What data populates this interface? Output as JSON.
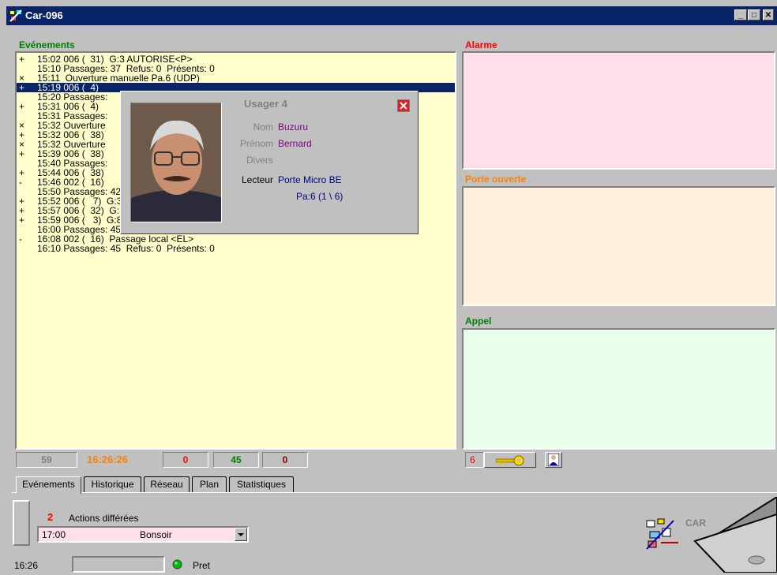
{
  "window": {
    "title": "Car-096",
    "minimize": "_",
    "maximize": "□",
    "close": "✕"
  },
  "events_label": "Evénements",
  "events": [
    {
      "prefix": "+",
      "text": "15:02 006 (  31)  G:3 AUTORISE<P>"
    },
    {
      "prefix": "",
      "text": "15:10 Passages: 37  Refus: 0  Présents: 0"
    },
    {
      "prefix": "×",
      "text": "15:11  Ouverture manuelle Pa.6 (UDP)"
    },
    {
      "prefix": "+",
      "text": "15:19 006 (  4)",
      "selected": true
    },
    {
      "prefix": "",
      "text": "15:20 Passages:"
    },
    {
      "prefix": "+",
      "text": "15:31 006 (  4)"
    },
    {
      "prefix": "",
      "text": "15:31 Passages:"
    },
    {
      "prefix": "×",
      "text": "15:32 Ouverture"
    },
    {
      "prefix": "+",
      "text": "15:32 006 (  38)"
    },
    {
      "prefix": "×",
      "text": "15:32 Ouverture"
    },
    {
      "prefix": "+",
      "text": "15:39 006 (  38)"
    },
    {
      "prefix": "",
      "text": "15:40 Passages:"
    },
    {
      "prefix": "+",
      "text": "15:44 006 (  38)"
    },
    {
      "prefix": "-",
      "text": "15:46 002 (  16)"
    },
    {
      "prefix": "",
      "text": "15:50 Passages: 42  Refus: 0  Présents: 0"
    },
    {
      "prefix": "+",
      "text": "15:52 006 (   7)  G:3 AUTORISE<P>"
    },
    {
      "prefix": "+",
      "text": "15:57 006 (  32)  G:3 AUTORISE<P>"
    },
    {
      "prefix": "+",
      "text": "15:59 006 (   3)  G:8 AUTORISE<P>"
    },
    {
      "prefix": "",
      "text": "16:00 Passages: 45  Refus: 0  Présents: 0"
    },
    {
      "prefix": "-",
      "text": "16:08 002 (  16)  Passage local <EL>"
    },
    {
      "prefix": "",
      "text": "16:10 Passages: 45  Refus: 0  Présents: 0"
    }
  ],
  "popup": {
    "title": "Usager 4",
    "nom_label": "Nom",
    "nom": "Buzuru",
    "prenom_label": "Prénom",
    "prenom": "Bernard",
    "divers_label": "Divers",
    "lecteur_label": "Lecteur",
    "lecteur": "Porte Micro BE",
    "pa": "Pa:6  (1 \\ 6)"
  },
  "panels": {
    "alarme": "Alarme",
    "porte": "Porte ouverte",
    "appel": "Appel"
  },
  "counters": {
    "c1": "59",
    "time": "16:26:26",
    "c2": "0",
    "c3": "45",
    "c4": "0",
    "doors": "6"
  },
  "tabs": [
    "Evénements",
    "Historique",
    "Réseau",
    "Plan",
    "Statistiques"
  ],
  "deferred": {
    "count": "2",
    "label": "Actions différées",
    "time": "17:00",
    "action": "Bonsoir"
  },
  "status": {
    "clock": "16:26",
    "state": "Pret"
  },
  "logo_text": "CAR",
  "colors": {
    "events_label": "#008000",
    "alarme": "#ff0000",
    "porte": "#ff8000",
    "appel": "#008000",
    "alarme_bg": "#ffe0e8",
    "porte_bg": "#fff0dc",
    "appel_bg": "#e8ffe8"
  }
}
